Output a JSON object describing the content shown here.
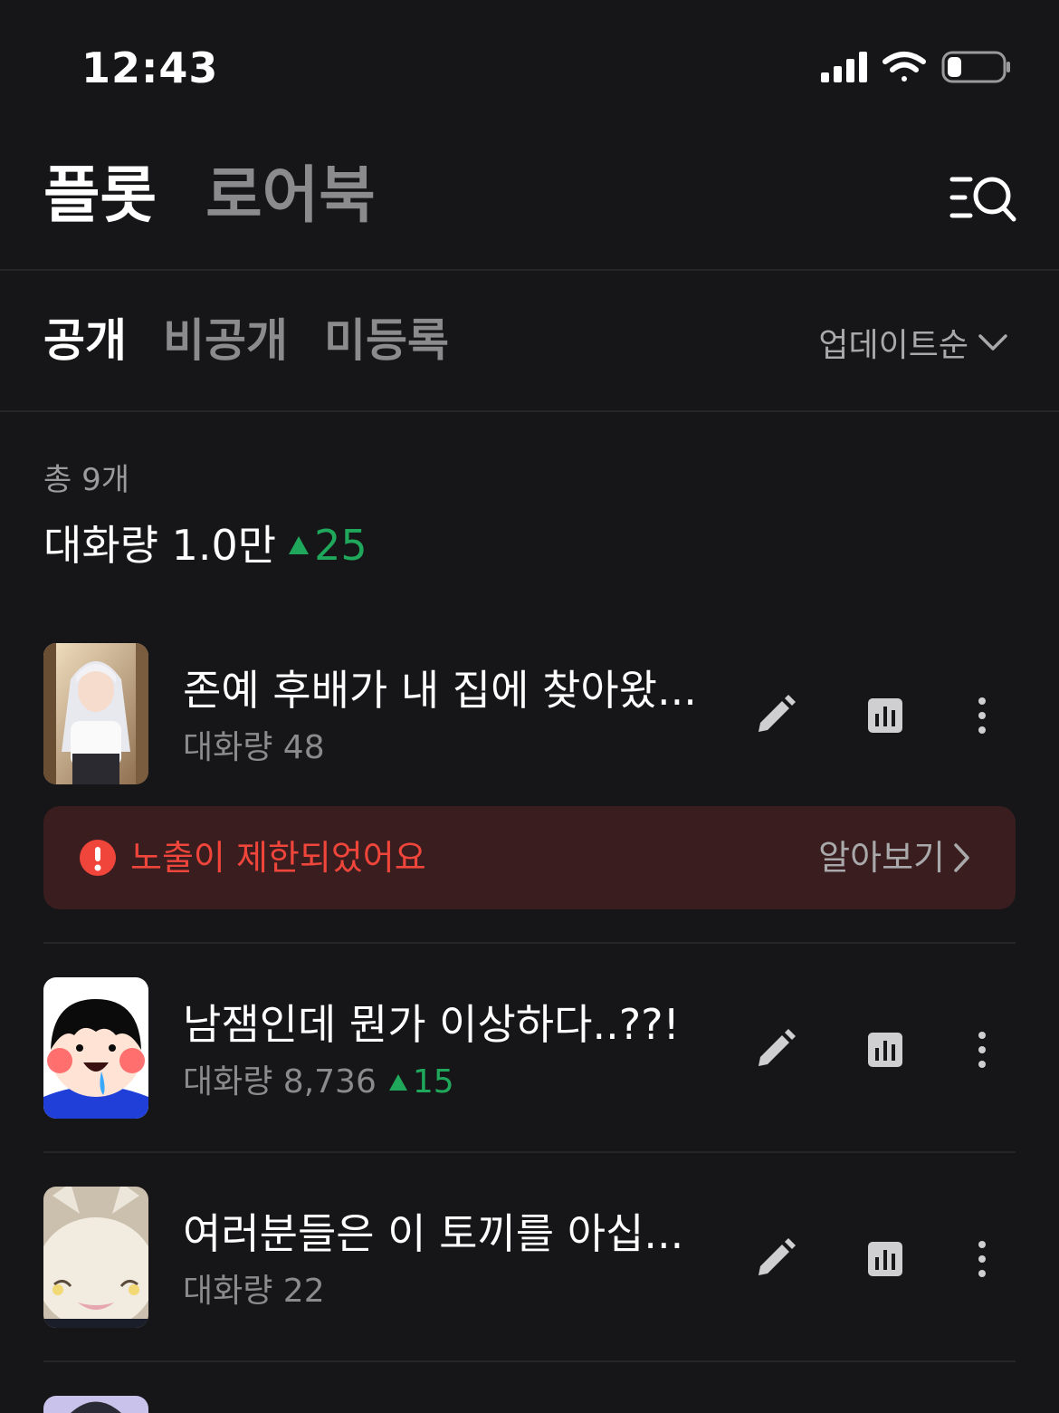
{
  "status_bar": {
    "time": "12:43"
  },
  "header": {
    "tabs": [
      {
        "label": "플롯",
        "active": true
      },
      {
        "label": "로어북",
        "active": false
      }
    ],
    "search_menu_icon": "list-search-icon"
  },
  "subtabs": {
    "items": [
      {
        "label": "공개",
        "active": true
      },
      {
        "label": "비공개",
        "active": false
      },
      {
        "label": "미등록",
        "active": false
      }
    ],
    "sort_label": "업데이트순"
  },
  "summary": {
    "total": "총 9개",
    "conversation_label": "대화량 1.0만",
    "conversation_delta": "25"
  },
  "items": [
    {
      "title": "존예 후배가 내 집에 찾아왔...",
      "stat": "대화량 48",
      "delta": "",
      "thumb": "anime-girl-thumbnail"
    },
    {
      "title": "남잼인데 뭔가 이상하다..??!",
      "stat": "대화량 8,736",
      "delta": "15",
      "thumb": "cartoon-boy-thumbnail"
    },
    {
      "title": "여러분들은 이 토끼를 아십...",
      "stat": "대화량 22",
      "delta": "",
      "thumb": "bunny-plush-thumbnail"
    }
  ],
  "banner": {
    "message": "노출이 제한되었어요",
    "action": "알아보기"
  },
  "colors": {
    "background": "#161618",
    "accent_green": "#1fa85b",
    "warning_red": "#f0453b",
    "banner_bg": "#3a1e1f"
  }
}
